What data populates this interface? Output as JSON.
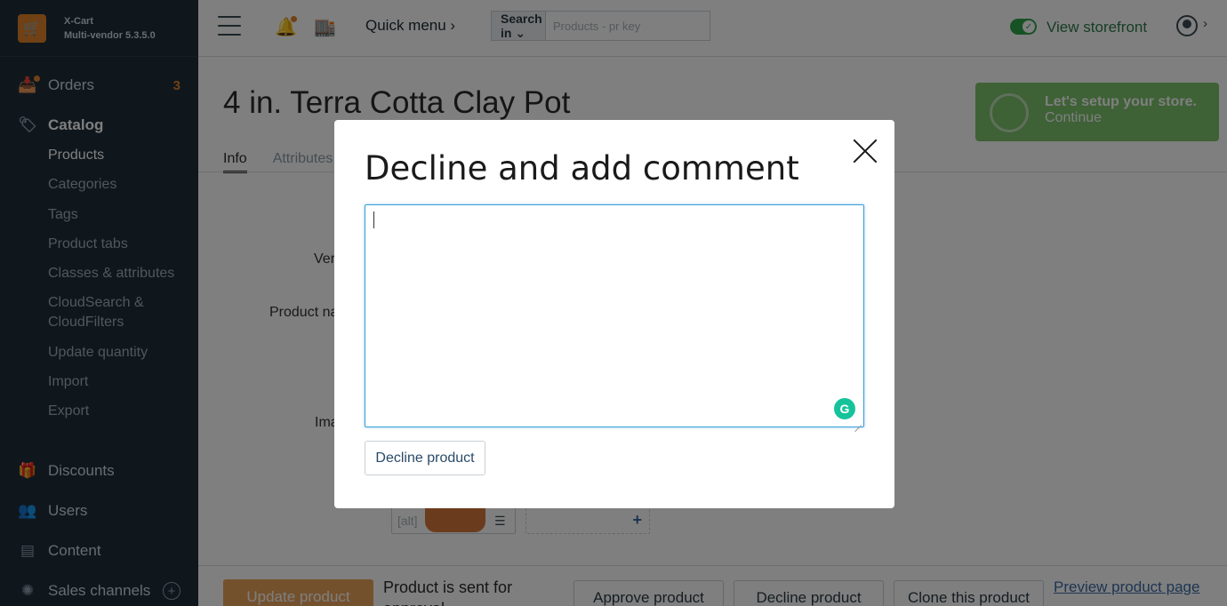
{
  "brand": {
    "name": "X-Cart",
    "version": "Multi-vendor 5.3.5.0"
  },
  "sidebar": {
    "orders": {
      "label": "Orders",
      "count": "3"
    },
    "catalog": {
      "label": "Catalog"
    },
    "catalog_items": [
      "Products",
      "Categories",
      "Tags",
      "Product tabs",
      "Classes & attributes",
      "CloudSearch & CloudFilters",
      "Update quantity",
      "Import",
      "Export"
    ],
    "discounts": {
      "label": "Discounts"
    },
    "users": {
      "label": "Users"
    },
    "content": {
      "label": "Content"
    },
    "sales_channels": {
      "label": "Sales channels"
    }
  },
  "header": {
    "quick_menu": "Quick menu ›",
    "search_in": "Search in ⌄",
    "search_placeholder": "Products - pr key",
    "view_storefront": "View storefront"
  },
  "page": {
    "title": "4 in. Terra Cotta Clay Pot",
    "tabs": [
      "Info",
      "Attributes"
    ],
    "labels": {
      "vendor": "Ver",
      "product_name": "Product na",
      "images": "Ima"
    },
    "image_alt": "[alt]"
  },
  "setup_banner": {
    "title": "Let's setup your store.",
    "link": "Continue"
  },
  "footer": {
    "update_button": "Update product",
    "sent_text": "Product is sent for approval",
    "approve_button": "Approve product",
    "decline_button": "Decline product",
    "clone_button": "Clone this product",
    "preview_link": "Preview product page"
  },
  "modal": {
    "title": "Decline and add comment",
    "comment_value": "",
    "submit_label": "Decline product"
  },
  "colors": {
    "sidebar_bg": "#1f2f3a",
    "accent_orange": "#e0822a",
    "storefront_green": "#2ea54a",
    "textarea_focus": "#3aa0d8"
  }
}
